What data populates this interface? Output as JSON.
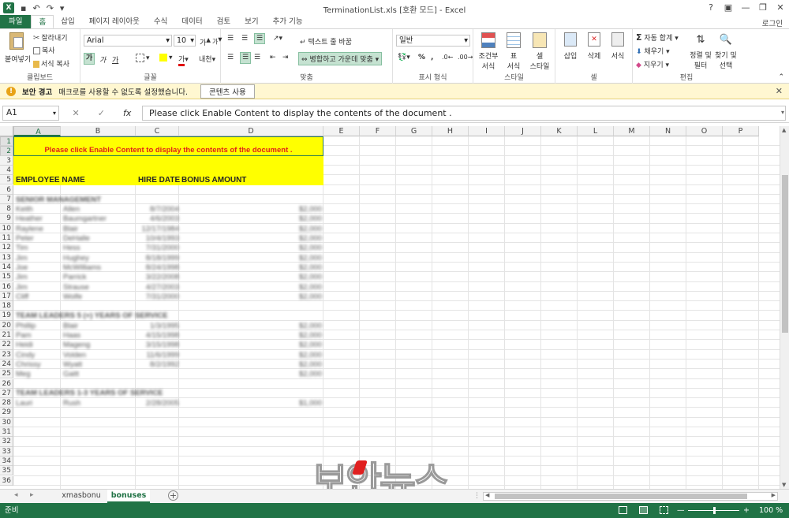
{
  "window": {
    "title": "TerminationList.xls  [호환 모드] - Excel",
    "login": "로그인",
    "controls": [
      "?",
      "▣",
      "—",
      "❐",
      "✕"
    ]
  },
  "ribbon_tabs": [
    "파일",
    "홈",
    "삽입",
    "페이지 레이아웃",
    "수식",
    "데이터",
    "검토",
    "보기",
    "추가 기능"
  ],
  "clipboard": {
    "paste": "붙여넣기",
    "cut": "잘라내기",
    "copy": "복사",
    "format_painter": "서식 복사",
    "label": "클립보드"
  },
  "font": {
    "name": "Arial",
    "size": "10",
    "label": "글꼴",
    "grow": "가",
    "shrink": "가",
    "bold": "가",
    "italic": "가",
    "underline": "가",
    "font_color_glyph": "가",
    "phonetic": "내천"
  },
  "alignment": {
    "wrap": "텍스트 줄 바꿈",
    "merge": "병합하고 가운데 맞춤",
    "label": "맞춤"
  },
  "number": {
    "format": "일반",
    "percent": "%",
    "comma": ",",
    "label": "표시 형식"
  },
  "styles": {
    "conditional_l1": "조건부",
    "conditional_l2": "서식",
    "table_l1": "표",
    "table_l2": "서식",
    "cell_l1": "셀",
    "cell_l2": "스타일",
    "label": "스타일"
  },
  "cells": {
    "insert": "삽입",
    "delete": "삭제",
    "format": "서식",
    "label": "셀"
  },
  "editing": {
    "autosum": "자동 합계",
    "fill": "채우기",
    "clear": "지우기",
    "sort_l1": "정렬 및",
    "sort_l2": "필터",
    "find_l1": "찾기 및",
    "find_l2": "선택",
    "label": "편집"
  },
  "message_bar": {
    "title": "보안 경고",
    "text": "매크로를 사용할 수 없도록 설정했습니다.",
    "button": "콘텐츠 사용"
  },
  "formula_bar": {
    "name_box": "A1",
    "cancel": "✕",
    "enter": "✓",
    "fx": "fx",
    "content": "Please click Enable Content to display the contents of the document ."
  },
  "columns": [
    "A",
    "B",
    "C",
    "D",
    "E",
    "F",
    "G",
    "H",
    "I",
    "J",
    "K",
    "L",
    "M",
    "N",
    "O",
    "P"
  ],
  "rows": [
    "1",
    "2",
    "3",
    "4",
    "5",
    "6",
    "7",
    "8",
    "9",
    "10",
    "11",
    "12",
    "13",
    "14",
    "15",
    "16",
    "17",
    "18",
    "19",
    "20",
    "21",
    "22",
    "23",
    "24",
    "25",
    "26",
    "27",
    "28",
    "29",
    "30",
    "31",
    "32",
    "33",
    "34",
    "35",
    "36"
  ],
  "sheet": {
    "banner": "Please click Enable Content to display the contents of the document .",
    "headers": [
      "EMPLOYEE NAME",
      "HIRE DATE",
      "BONUS AMOUNT"
    ],
    "sections": [
      "SENIOR MANAGEMENT",
      "TEAM LEADERS 5 (+) YEARS OF SERVICE",
      "TEAM LEADERS 1-3 YEARS OF SERVICE"
    ],
    "blurred_rows": [
      [
        "Keith",
        "Allen",
        "8/7/2004",
        "$2,000"
      ],
      [
        "Heather",
        "Baumgartner",
        "4/6/2003",
        "$2,000"
      ],
      [
        "Raylene",
        "Blair",
        "12/17/1984",
        "$2,000"
      ],
      [
        "Peter",
        "DeHalle",
        "10/4/1993",
        "$2,000"
      ],
      [
        "Tim",
        "Hess",
        "7/31/2000",
        "$2,000"
      ],
      [
        "Jim",
        "Hughey",
        "8/18/1999",
        "$2,000"
      ],
      [
        "Joe",
        "McWilliams",
        "8/24/1998",
        "$2,000"
      ],
      [
        "Jim",
        "Parrick",
        "3/22/2008",
        "$2,000"
      ],
      [
        "Jim",
        "Strause",
        "4/27/2003",
        "$2,000"
      ],
      [
        "Cliff",
        "Wolfe",
        "7/31/2000",
        "$2,000"
      ],
      [
        "Phillip",
        "Blair",
        "1/3/1995",
        "$2,000"
      ],
      [
        "Pam",
        "Haas",
        "4/15/1998",
        "$2,000"
      ],
      [
        "Heidi",
        "Mageng",
        "3/15/1998",
        "$2,000"
      ],
      [
        "Cindy",
        "Volden",
        "11/6/1999",
        "$2,000"
      ],
      [
        "Chrissy",
        "Wyatt",
        "8/2/1992",
        "$2,000"
      ],
      [
        "Meg",
        "Gaitt",
        "",
        "$2,000"
      ],
      [
        "Lauri",
        "Rush",
        "2/28/2005",
        "$1,000"
      ]
    ]
  },
  "sheet_tabs": [
    "xmasbonu",
    "bonuses"
  ],
  "status": {
    "ready": "준비",
    "zoom": "100 %",
    "zoom_value": 1.0
  },
  "watermark": "보안뉴스",
  "colors": {
    "excel_green": "#217346",
    "banner_yellow": "#ffff00",
    "banner_text": "#e0201b"
  }
}
